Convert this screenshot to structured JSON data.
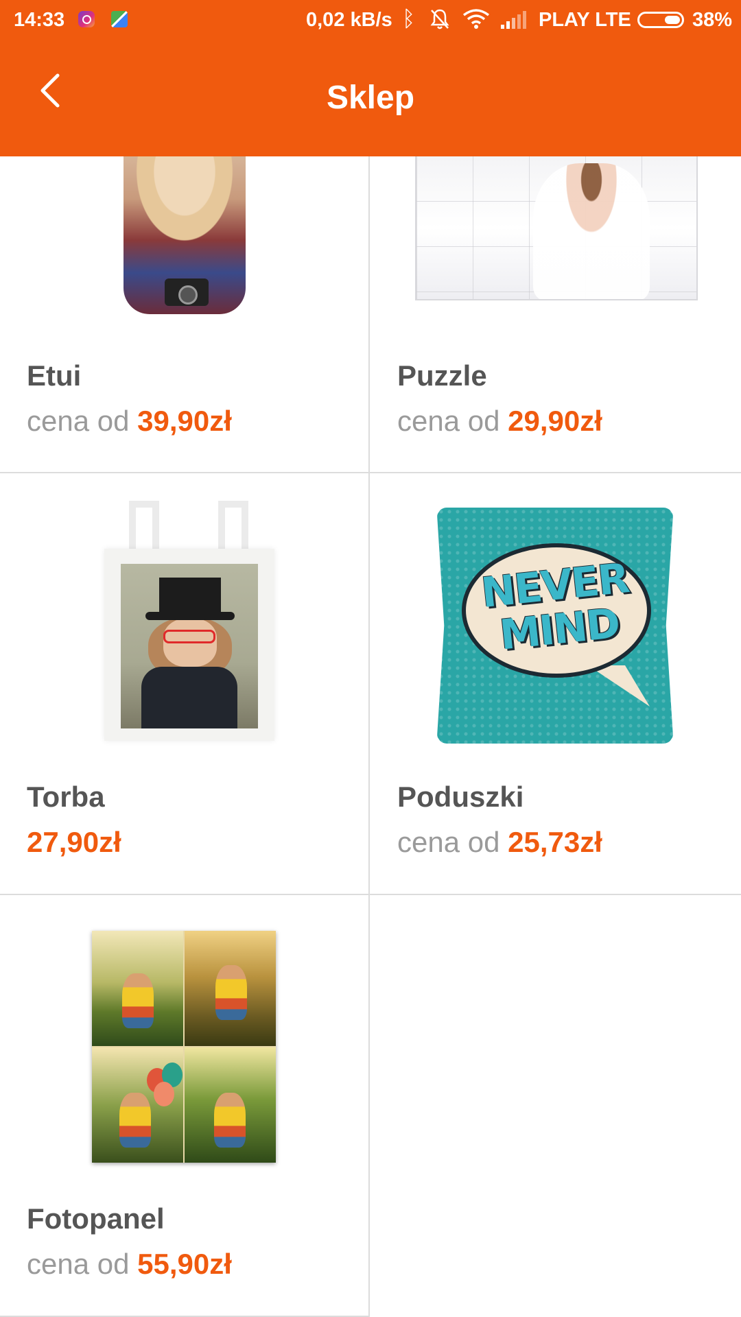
{
  "status_bar": {
    "time": "14:33",
    "net_speed": "0,02 kB/s",
    "carrier": "PLAY LTE",
    "battery": "38%",
    "battery_level": 0.38,
    "icons": [
      "instagram-icon",
      "maps-icon",
      "bluetooth-icon",
      "bell-off-icon",
      "wifi-icon",
      "signal-icon",
      "battery-icon"
    ]
  },
  "app_bar": {
    "title": "Sklep",
    "back_icon": "chevron-left-icon"
  },
  "colors": {
    "accent": "#f05a0e",
    "name_text": "#555555",
    "muted_text": "#9a9a9a",
    "divider": "#dcdcdc"
  },
  "products": [
    {
      "name": "Etui",
      "price_prefix": "cena od ",
      "price": "39,90zł"
    },
    {
      "name": "Puzzle",
      "price_prefix": "cena od ",
      "price": "29,90zł"
    },
    {
      "name": "Torba",
      "price_prefix": "",
      "price": "27,90zł"
    },
    {
      "name": "Poduszki",
      "price_prefix": "cena od ",
      "price": "25,73zł"
    },
    {
      "name": "Fotopanel",
      "price_prefix": "cena od ",
      "price": "55,90zł"
    }
  ],
  "pillow_print": {
    "line1": "NEVER",
    "line2": "MIND"
  }
}
